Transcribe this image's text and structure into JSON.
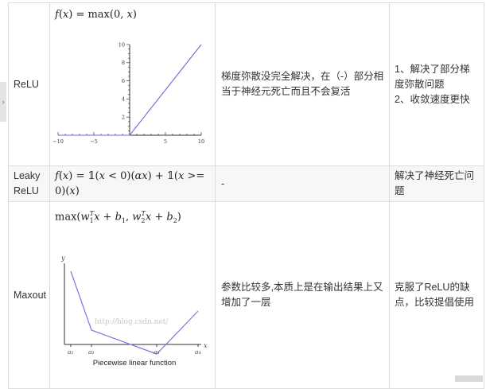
{
  "rows": [
    {
      "name": "ReLU",
      "formula": "f(x) = max(0, x)",
      "description": "梯度弥散没完全解决，在（-）部分相当于神经元死亡而且不会复活",
      "notes": [
        "1、解决了部分梯度弥散问题",
        "2、收敛速度更快"
      ]
    },
    {
      "name": "Leaky ReLU",
      "formula": "f(x) = 𝟙(x < 0)(αx) + 𝟙(x >= 0)(x)",
      "description": "-",
      "notes": [
        "解决了神经死亡问题"
      ]
    },
    {
      "name": "Maxout",
      "formula": "max(w₁ᵀx + b₁, w₂ᵀx + b₂)",
      "description": "参数比较多,本质上是在输出结果上又增加了一层",
      "notes": [
        "克服了ReLU的缺点，比较提倡使用"
      ]
    }
  ],
  "relu_plot": {
    "chart_data": {
      "type": "line",
      "x": [
        -10,
        0,
        10
      ],
      "y": [
        0,
        0,
        10
      ],
      "xlim": [
        -10,
        10
      ],
      "ylim": [
        0,
        10
      ],
      "x_ticks": [
        -10,
        -5,
        5,
        10
      ],
      "y_ticks": [
        2,
        4,
        6,
        8,
        10
      ],
      "line_color": "#6a6ad8"
    }
  },
  "maxout_figure": {
    "y_label": "y",
    "x_label": "x",
    "x_ticks": [
      "a₁",
      "a₂",
      "a₃",
      "a₄"
    ],
    "watermark": "http://blog.csdn.net/",
    "caption": "Piecewise linear function",
    "line_color": "#7878e0"
  }
}
